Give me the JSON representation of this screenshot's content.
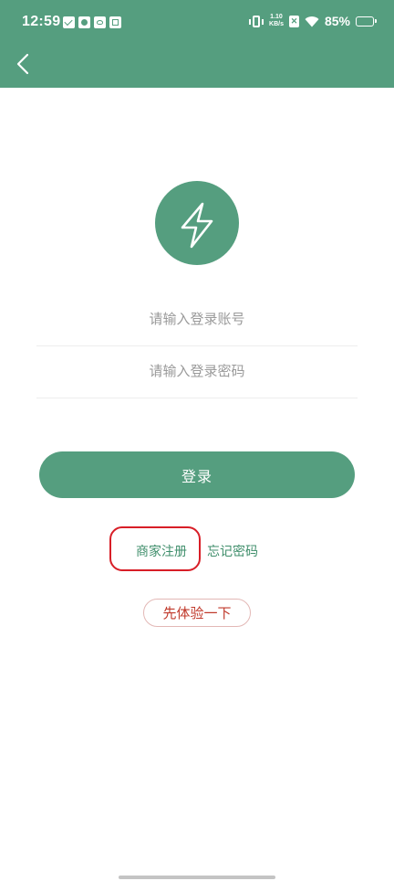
{
  "status_bar": {
    "time": "12:59",
    "net_speed_value": "1.10",
    "net_speed_unit": "KB/s",
    "battery_level": "85%",
    "battery_fraction": 0.85
  },
  "header": {
    "background_color": "#559e7f"
  },
  "logo": {
    "icon": "lightning-bolt-icon",
    "color": "#559e7f"
  },
  "form": {
    "account_placeholder": "请输入登录账号",
    "password_placeholder": "请输入登录密码",
    "account_value": "",
    "password_value": ""
  },
  "login_button": {
    "label": "登录"
  },
  "links": {
    "register": "商家注册",
    "forgot_password": "忘记密码"
  },
  "trial_button": {
    "label": "先体验一下"
  },
  "colors": {
    "accent": "#559e7f",
    "link": "#3f8e6b",
    "highlight": "#d81e27",
    "trial_text": "#c0392b"
  }
}
